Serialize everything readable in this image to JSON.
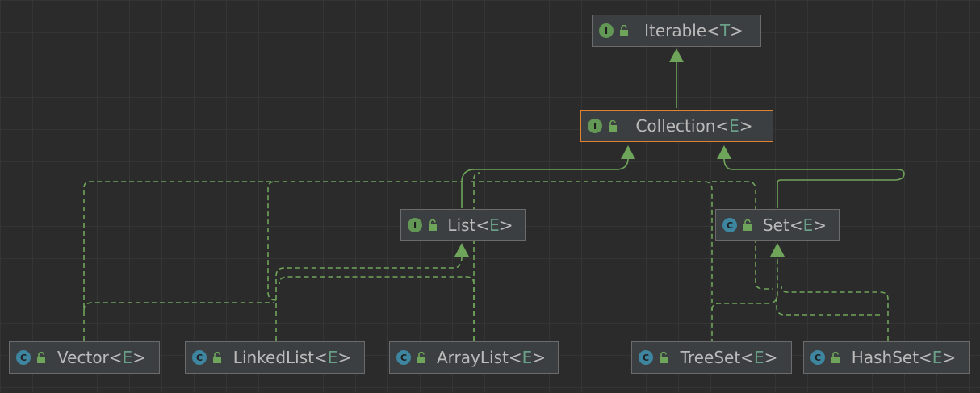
{
  "colors": {
    "background": "#2b2b2b",
    "grid": "#353535",
    "node_bg": "#3c3f41",
    "node_border": "#6b6b6b",
    "selected_border": "#e0822f",
    "edge": "#6fa55a",
    "interface_badge": "#629755",
    "class_badge": "#3e86a0",
    "type_param": "#6a9f88",
    "text": "#bbbbbb"
  },
  "nodes": {
    "iterable": {
      "badge": "I",
      "kind": "interface",
      "name": "Iterable",
      "tparam": "T",
      "lock_icon": "lock-open-icon"
    },
    "collection": {
      "badge": "I",
      "kind": "interface",
      "name": "Collection",
      "tparam": "E",
      "lock_icon": "lock-open-icon",
      "selected": true
    },
    "list": {
      "badge": "I",
      "kind": "interface",
      "name": "List",
      "tparam": "E",
      "lock_icon": "lock-open-icon"
    },
    "set": {
      "badge": "C",
      "kind": "class",
      "name": "Set",
      "tparam": "E",
      "lock_icon": "lock-open-icon"
    },
    "vector": {
      "badge": "C",
      "kind": "class",
      "name": "Vector",
      "tparam": "E",
      "lock_icon": "lock-open-icon"
    },
    "linkedlist": {
      "badge": "C",
      "kind": "class",
      "name": "LinkedList",
      "tparam": "E",
      "lock_icon": "lock-open-icon"
    },
    "arraylist": {
      "badge": "C",
      "kind": "class",
      "name": "ArrayList",
      "tparam": "E",
      "lock_icon": "lock-open-icon"
    },
    "treeset": {
      "badge": "C",
      "kind": "class",
      "name": "TreeSet",
      "tparam": "E",
      "lock_icon": "lock-open-icon"
    },
    "hashset": {
      "badge": "C",
      "kind": "class",
      "name": "HashSet",
      "tparam": "E",
      "lock_icon": "lock-open-icon"
    }
  },
  "edges": [
    {
      "from": "collection",
      "to": "iterable",
      "style": "solid"
    },
    {
      "from": "list",
      "to": "collection",
      "style": "solid"
    },
    {
      "from": "set",
      "to": "collection",
      "style": "solid"
    },
    {
      "from": "vector",
      "to": "collection",
      "style": "dashed"
    },
    {
      "from": "linkedlist",
      "to": "collection",
      "style": "dashed"
    },
    {
      "from": "arraylist",
      "to": "collection",
      "style": "dashed"
    },
    {
      "from": "treeset",
      "to": "collection",
      "style": "dashed"
    },
    {
      "from": "hashset",
      "to": "collection",
      "style": "dashed"
    },
    {
      "from": "vector",
      "to": "list",
      "style": "dashed"
    },
    {
      "from": "linkedlist",
      "to": "list",
      "style": "dashed"
    },
    {
      "from": "arraylist",
      "to": "list",
      "style": "dashed"
    },
    {
      "from": "treeset",
      "to": "set",
      "style": "dashed"
    },
    {
      "from": "hashset",
      "to": "set",
      "style": "dashed"
    }
  ]
}
